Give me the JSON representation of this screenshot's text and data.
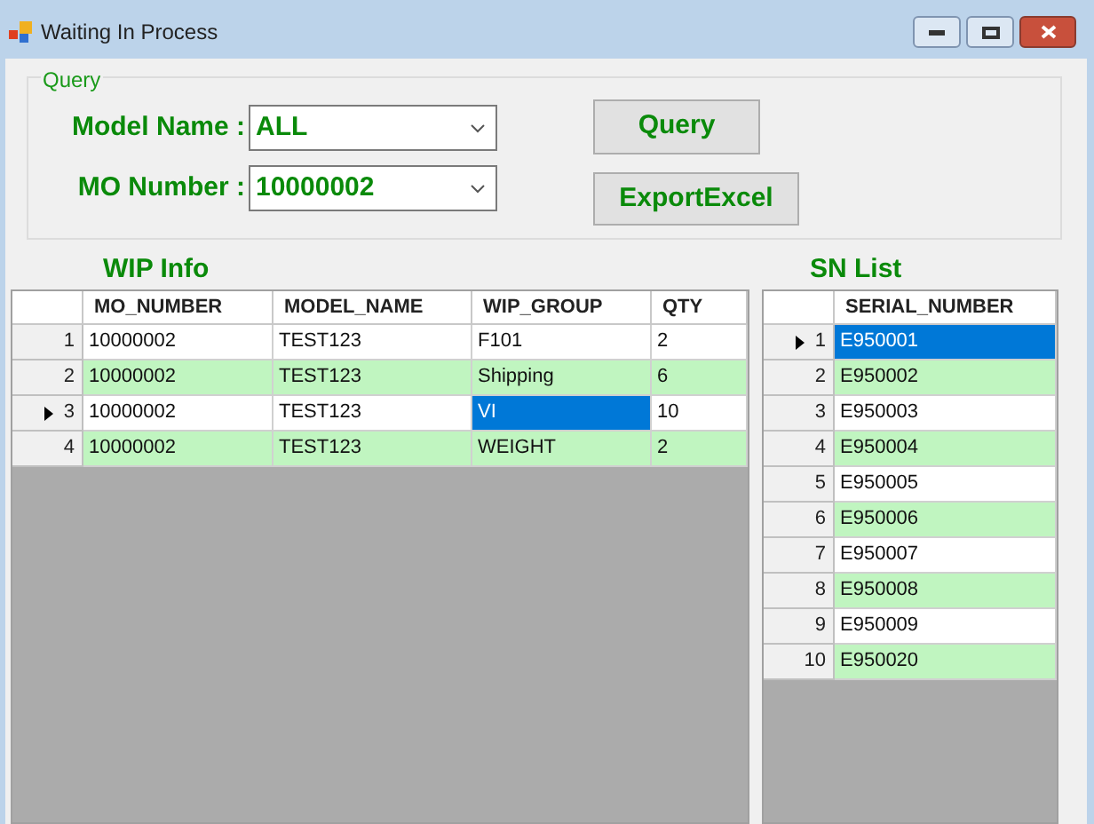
{
  "window": {
    "title": "Waiting In Process"
  },
  "query": {
    "title": "Query",
    "fields": [
      {
        "label": "Model Name :",
        "value": "ALL"
      },
      {
        "label": "MO Number :",
        "value": "10000002"
      }
    ],
    "buttons": [
      "Query",
      "ExportExcel"
    ]
  },
  "wip_info": {
    "title": "WIP Info",
    "columns": [
      "MO_NUMBER",
      "MODEL_NAME",
      "WIP_GROUP",
      "QTY"
    ],
    "rows": [
      {
        "number": "1",
        "current": false,
        "cells": [
          {
            "text": "10000002",
            "selected": false
          },
          {
            "text": "TEST123",
            "selected": false
          },
          {
            "text": "F101",
            "selected": false
          },
          {
            "text": "2",
            "selected": false
          }
        ]
      },
      {
        "number": "2",
        "current": false,
        "cells": [
          {
            "text": "10000002",
            "selected": false
          },
          {
            "text": "TEST123",
            "selected": false
          },
          {
            "text": "Shipping",
            "selected": false
          },
          {
            "text": "6",
            "selected": false
          }
        ]
      },
      {
        "number": "3",
        "current": true,
        "cells": [
          {
            "text": "10000002",
            "selected": false
          },
          {
            "text": "TEST123",
            "selected": false
          },
          {
            "text": "VI",
            "selected": true
          },
          {
            "text": "10",
            "selected": false
          }
        ]
      },
      {
        "number": "4",
        "current": false,
        "cells": [
          {
            "text": "10000002",
            "selected": false
          },
          {
            "text": "TEST123",
            "selected": false
          },
          {
            "text": "WEIGHT",
            "selected": false
          },
          {
            "text": "2",
            "selected": false
          }
        ]
      }
    ]
  },
  "sn_list": {
    "title": "SN List",
    "columns": [
      "SERIAL_NUMBER"
    ],
    "rows": [
      {
        "number": "1",
        "current": true,
        "cells": [
          {
            "text": "E950001",
            "selected": true
          }
        ]
      },
      {
        "number": "2",
        "current": false,
        "cells": [
          {
            "text": "E950002",
            "selected": false
          }
        ]
      },
      {
        "number": "3",
        "current": false,
        "cells": [
          {
            "text": "E950003",
            "selected": false
          }
        ]
      },
      {
        "number": "4",
        "current": false,
        "cells": [
          {
            "text": "E950004",
            "selected": false
          }
        ]
      },
      {
        "number": "5",
        "current": false,
        "cells": [
          {
            "text": "E950005",
            "selected": false
          }
        ]
      },
      {
        "number": "6",
        "current": false,
        "cells": [
          {
            "text": "E950006",
            "selected": false
          }
        ]
      },
      {
        "number": "7",
        "current": false,
        "cells": [
          {
            "text": "E950007",
            "selected": false
          }
        ]
      },
      {
        "number": "8",
        "current": false,
        "cells": [
          {
            "text": "E950008",
            "selected": false
          }
        ]
      },
      {
        "number": "9",
        "current": false,
        "cells": [
          {
            "text": "E950009",
            "selected": false
          }
        ]
      },
      {
        "number": "10",
        "current": false,
        "cells": [
          {
            "text": "E950020",
            "selected": false
          }
        ]
      }
    ]
  }
}
